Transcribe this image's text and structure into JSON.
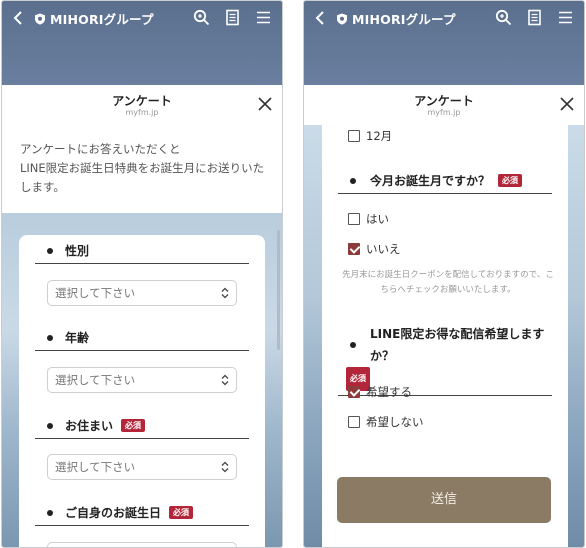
{
  "app": {
    "title": "MIHORIグループ"
  },
  "sheet": {
    "title": "アンケート",
    "domain": "myfm.jp"
  },
  "left": {
    "intro": "アンケートにお答えいただくと\nLINE限定お誕生日特典をお誕生月にお送りいたします。",
    "fields": [
      {
        "label": "性別",
        "required": false,
        "placeholder": "選択して下さい"
      },
      {
        "label": "年齢",
        "required": false,
        "placeholder": "選択して下さい"
      },
      {
        "label": "お住まい",
        "required": true,
        "placeholder": "選択して下さい"
      },
      {
        "label": "ご自身のお誕生日",
        "required": true,
        "placeholder": ""
      }
    ],
    "required_badge": "必須"
  },
  "right": {
    "month_option": "12月",
    "q1": {
      "label": "今月お誕生月ですか？",
      "badge": "必須",
      "options": [
        {
          "label": "はい",
          "checked": false
        },
        {
          "label": "いいえ",
          "checked": true
        }
      ],
      "note": "先月末にお誕生日クーポンを配信しておりますので、こちらへチェックお願いいたします。"
    },
    "q2": {
      "label": "LINE限定お得な配信希望しますか？",
      "badge": "必須",
      "options": [
        {
          "label": "希望する",
          "checked": true
        },
        {
          "label": "希望しない",
          "checked": false
        }
      ]
    },
    "submit_label": "送信"
  },
  "icons": [
    "back-arrow-icon",
    "shield-icon",
    "search-icon",
    "document-icon",
    "menu-icon",
    "close-icon",
    "select-chevron-icon"
  ],
  "colors": {
    "header_bg": "#5b6f8e",
    "required_badge": "#b3263a",
    "checkbox_checked": "#8c3a3a",
    "submit_bg": "#8b7b65"
  }
}
